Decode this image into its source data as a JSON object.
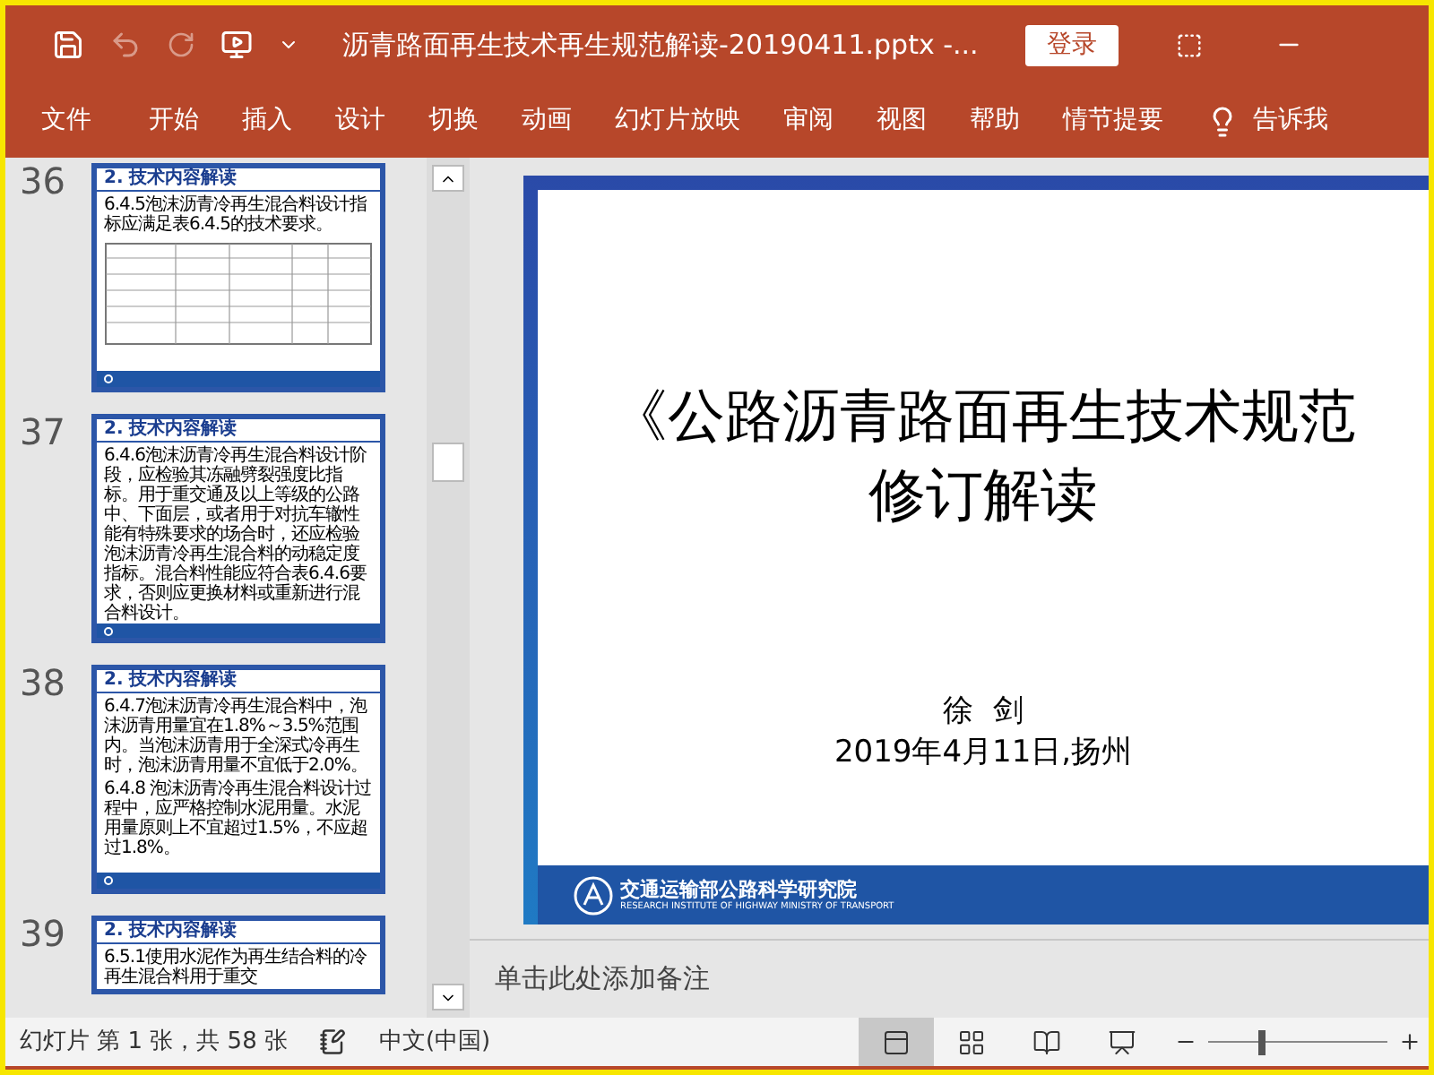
{
  "window": {
    "title": "沥青路面再生技术再生规范解读-20190411.pptx  -...",
    "login_button": "登录"
  },
  "ribbon_tabs": [
    {
      "label": "文件"
    },
    {
      "label": "开始"
    },
    {
      "label": "插入"
    },
    {
      "label": "设计"
    },
    {
      "label": "切换"
    },
    {
      "label": "动画"
    },
    {
      "label": "幻灯片放映"
    },
    {
      "label": "审阅"
    },
    {
      "label": "视图"
    },
    {
      "label": "帮助"
    },
    {
      "label": "情节提要"
    }
  ],
  "tell_me": "告诉我",
  "thumbnails": [
    {
      "number": "36",
      "heading": "2. 技术内容解读",
      "kind": "table",
      "body": [
        "6.4.5泡沫沥青冷再生混合料设计指标应满足表6.4.5的技术要求。"
      ]
    },
    {
      "number": "37",
      "heading": "2. 技术内容解读",
      "kind": "text",
      "body": [
        "6.4.6泡沫沥青冷再生混合料设计阶段，应检验其冻融劈裂强度比指标。用于重交通及以上等级的公路中、下面层，或者用于对抗车辙性能有特殊要求的场合时，还应检验泡沫沥青冷再生混合料的动稳定度指标。混合料性能应符合表6.4.6要求，否则应更换材料或重新进行混合料设计。"
      ]
    },
    {
      "number": "38",
      "heading": "2. 技术内容解读",
      "kind": "text",
      "body": [
        "6.4.7泡沫沥青冷再生混合料中，泡沫沥青用量宜在1.8%～3.5%范围内。当泡沫沥青用于全深式冷再生时，泡沫沥青用量不宜低于2.0%。",
        "6.4.8 泡沫沥青冷再生混合料设计过程中，应严格控制水泥用量。水泥用量原则上不宜超过1.5%，不应超过1.8%。"
      ]
    },
    {
      "number": "39",
      "heading": "2. 技术内容解读",
      "kind": "partial",
      "body": [
        "6.5.1使用水泥作为再生结合料的冷再生混合料用于重交"
      ]
    }
  ],
  "slide": {
    "title_lines": [
      "《公路沥青路面再生技术规范",
      "修订解读"
    ],
    "author": "徐  剑",
    "date": "2019年4月11日,扬州",
    "institute": "交通运输部公路科学研究院",
    "institute_en": "RESEARCH INSTITUTE OF HIGHWAY MINISTRY OF TRANSPORT"
  },
  "notes": {
    "placeholder": "单击此处添加备注"
  },
  "status_bar": {
    "slide_info": "幻灯片 第 1 张，共 58 张",
    "language": "中文(中国)",
    "views": [
      {
        "kind": "normal",
        "selected": true
      },
      {
        "kind": "sorter",
        "selected": false
      },
      {
        "kind": "reading",
        "selected": false
      },
      {
        "kind": "slideshow",
        "selected": false
      }
    ],
    "zoom": {
      "level": 0.3
    }
  }
}
